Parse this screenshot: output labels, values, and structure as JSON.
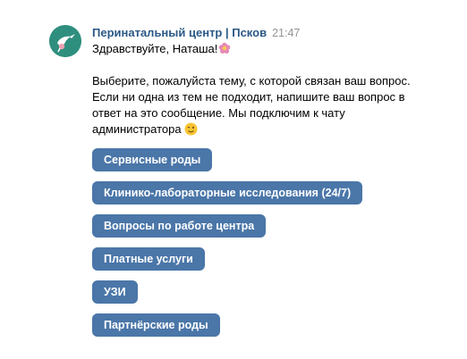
{
  "message": {
    "sender": "Перинатальный центр | Псков",
    "time": "21:47",
    "greeting": "Здравствуйте, Наташа!",
    "greeting_emoji": "flower-emoji",
    "body_lines": [
      "Выберите, пожалуйста тему, с которой связан ваш вопрос.",
      "Если ни одна из тем не подходит, напишите ваш вопрос в",
      "ответ на это сообщение. Мы подключим к чату",
      "администратора"
    ],
    "closing_emoji": "wink-emoji"
  },
  "keyboard": {
    "buttons": [
      "Сервисные роды",
      "Клинико-лабораторные исследования (24/7)",
      "Вопросы по работе центра",
      "Платные услуги",
      "УЗИ",
      "Партнёрские роды"
    ]
  },
  "colors": {
    "sender": "#2a5885",
    "button_bg": "#4a76a8",
    "avatar_bg": "#2f8f7e"
  }
}
